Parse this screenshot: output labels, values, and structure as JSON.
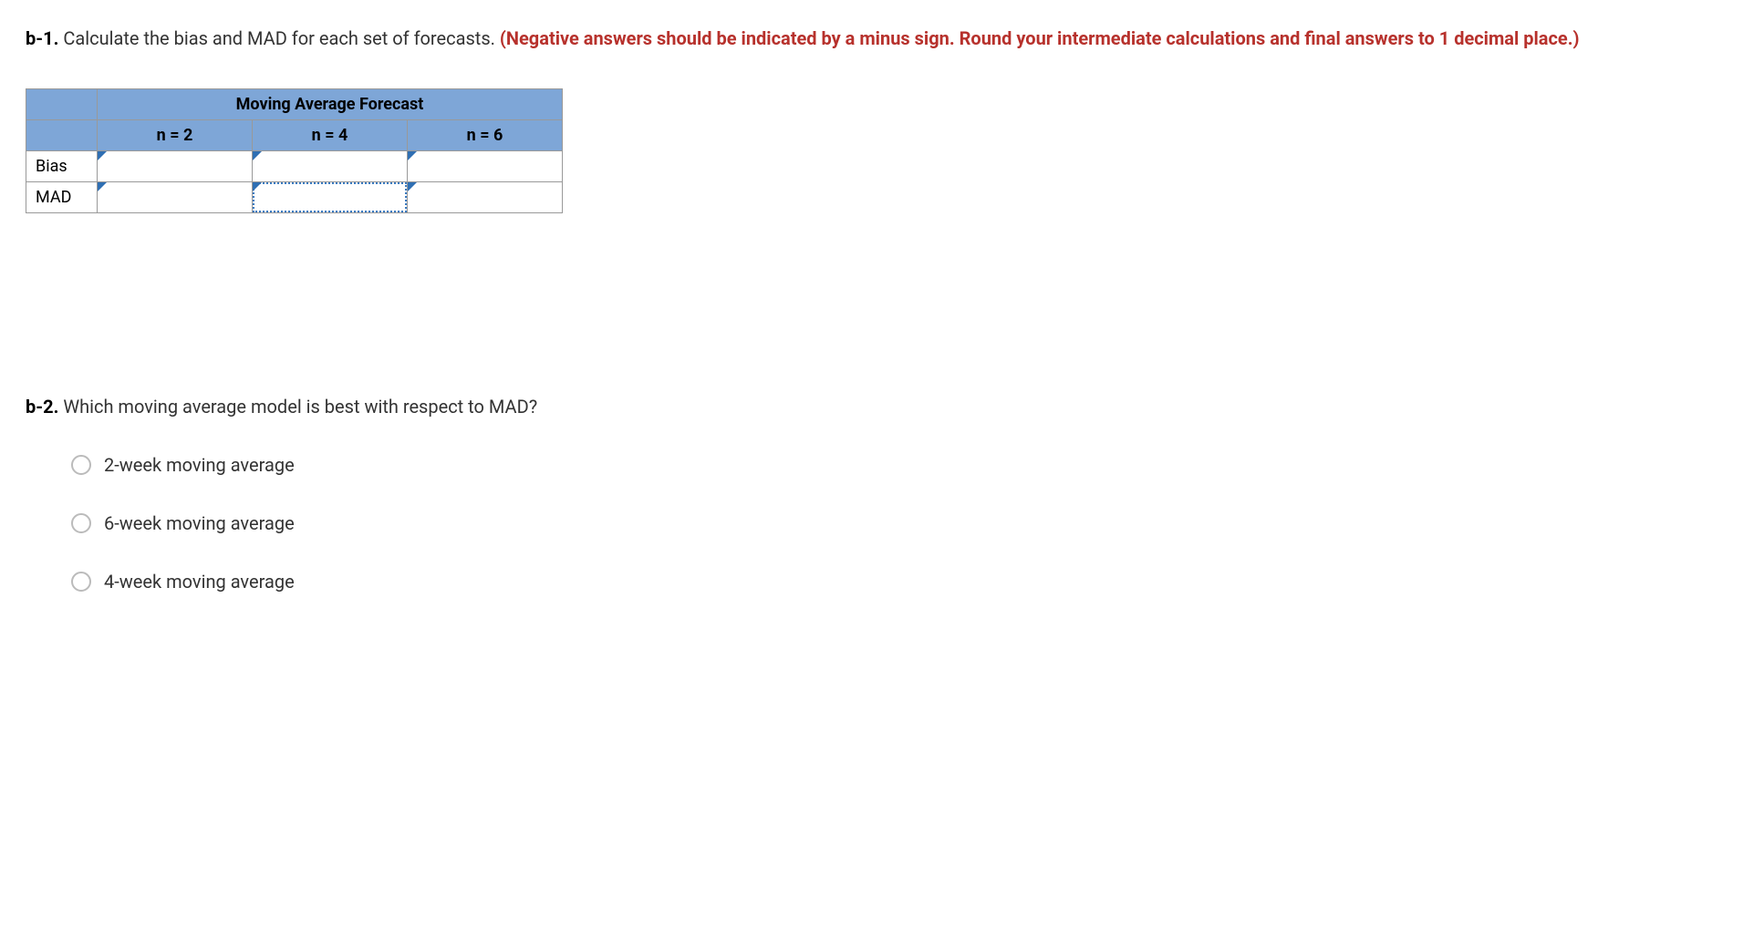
{
  "b1": {
    "label": "b-1.",
    "text_plain": " Calculate the bias and MAD for each set of forecasts. ",
    "text_red": "(Negative answers should be indicated by a minus sign. Round your intermediate calculations and final answers to 1 decimal place.)"
  },
  "table": {
    "title": "Moving Average Forecast",
    "columns": [
      "n = 2",
      "n = 4",
      "n = 6"
    ],
    "rows": [
      "Bias",
      "MAD"
    ],
    "values": {
      "bias_n2": "",
      "bias_n4": "",
      "bias_n6": "",
      "mad_n2": "",
      "mad_n4": "",
      "mad_n6": ""
    }
  },
  "b2": {
    "label": "b-2.",
    "text": " Which moving average model is best with respect to MAD?",
    "options": [
      "2-week moving average",
      "6-week moving average",
      "4-week moving average"
    ]
  }
}
